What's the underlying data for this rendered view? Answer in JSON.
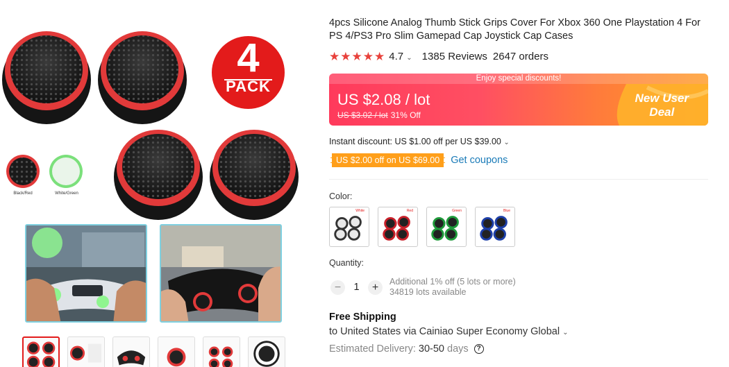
{
  "gallery": {
    "badge_number": "4",
    "badge_word": "PACK",
    "color_labels": [
      "Black/Red",
      "White/Green"
    ],
    "thumb_count": 6
  },
  "product": {
    "title": "4pcs Silicone Analog Thumb Stick Grips Cover For Xbox 360 One Playstation 4 For PS 4/PS3 Pro Slim Gamepad Cap Joystick Cap Cases",
    "rating_value": "4.7",
    "rating_stars": 5,
    "reviews": "1385 Reviews",
    "orders": "2647 orders"
  },
  "price": {
    "banner": "Enjoy special discounts!",
    "current": "US $2.08 / lot",
    "original": "US $3.02 / lot",
    "discount": "31% Off",
    "deal_line1": "New User",
    "deal_line2": "Deal"
  },
  "discounts": {
    "instant": "Instant discount: US $1.00 off per US $39.00",
    "coupon_tag": "US $2.00 off on US $69.00",
    "get_coupons": "Get coupons"
  },
  "color": {
    "label": "Color:",
    "options": [
      {
        "name": "White",
        "accent": "#e9e9e9"
      },
      {
        "name": "Red",
        "accent": "#c8202a"
      },
      {
        "name": "Green",
        "accent": "#1f9a3a"
      },
      {
        "name": "Blue",
        "accent": "#1d3fa8"
      }
    ]
  },
  "quantity": {
    "label": "Quantity:",
    "minus": "−",
    "value": "1",
    "plus": "+",
    "note_line1": "Additional 1% off (5 lots or more)",
    "note_line2": "34819 lots available"
  },
  "shipping": {
    "title": "Free Shipping",
    "to": "to United States via Cainiao Super Economy Global",
    "eta_label": "Estimated Delivery:",
    "eta_value": "30-50",
    "eta_unit": "days",
    "help": "?"
  },
  "colors": {
    "accent_red": "#e8413b",
    "coupon_orange": "#ff9f1a",
    "link_blue": "#1a7bb8"
  }
}
